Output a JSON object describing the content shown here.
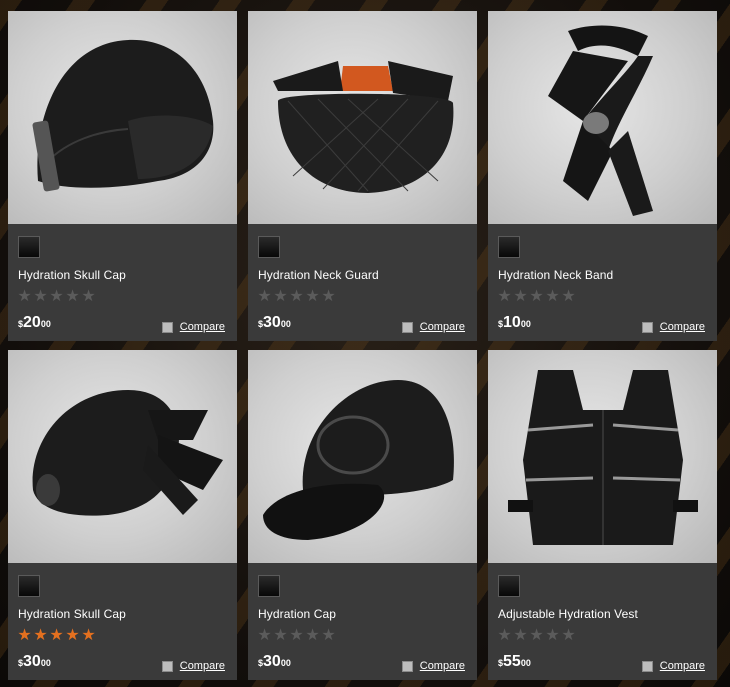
{
  "currency_symbol": "$",
  "compare_label": "Compare",
  "colors": {
    "star_on": "#e4701f",
    "star_off": "#5b5b5b",
    "card_bg": "#3a3a3a"
  },
  "products": [
    {
      "name": "Hydration Skull Cap",
      "rating": 0,
      "price_dollars": "20",
      "price_cents": "00",
      "image_icon": "skull-cap-icon",
      "swatch_color": "#000000"
    },
    {
      "name": "Hydration Neck Guard",
      "rating": 0,
      "price_dollars": "30",
      "price_cents": "00",
      "image_icon": "neck-guard-icon",
      "swatch_color": "#000000"
    },
    {
      "name": "Hydration Neck Band",
      "rating": 0,
      "price_dollars": "10",
      "price_cents": "00",
      "image_icon": "neck-band-icon",
      "swatch_color": "#000000"
    },
    {
      "name": "Hydration Skull Cap",
      "rating": 5,
      "price_dollars": "30",
      "price_cents": "00",
      "image_icon": "tied-skull-cap-icon",
      "swatch_color": "#000000"
    },
    {
      "name": "Hydration Cap",
      "rating": 0,
      "price_dollars": "30",
      "price_cents": "00",
      "image_icon": "baseball-cap-icon",
      "swatch_color": "#000000"
    },
    {
      "name": "Adjustable Hydration Vest",
      "rating": 0,
      "price_dollars": "55",
      "price_cents": "00",
      "image_icon": "vest-icon",
      "swatch_color": "#000000"
    }
  ]
}
